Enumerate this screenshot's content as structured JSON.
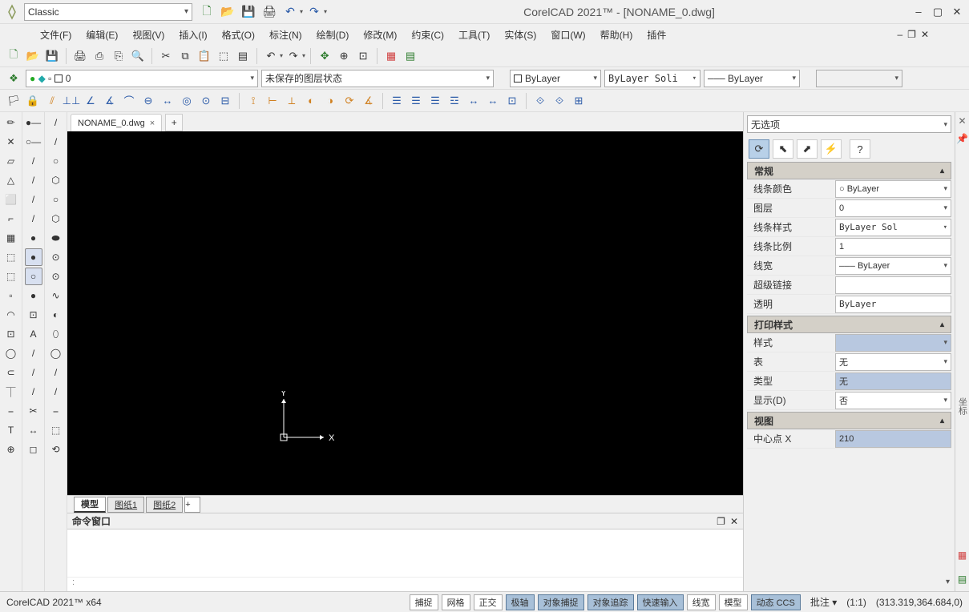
{
  "title": "CorelCAD 2021™ - [NONAME_0.dwg]",
  "workspace": "Classic",
  "menu": [
    "文件(F)",
    "编辑(E)",
    "视图(V)",
    "插入(I)",
    "格式(O)",
    "标注(N)",
    "绘制(D)",
    "修改(M)",
    "约束(C)",
    "工具(T)",
    "实体(S)",
    "窗口(W)",
    "帮助(H)",
    "插件"
  ],
  "layer_row": {
    "layer_combo": "0",
    "layer_state": "未保存的图层状态",
    "color": "ByLayer",
    "linestyle": "ByLayer   Soli",
    "lineweight": "ByLayer"
  },
  "doc_tab": "NONAME_0.dwg",
  "model_tabs": {
    "active": "模型",
    "sheets": [
      "图纸1",
      "图纸2"
    ]
  },
  "right_panel": {
    "selector": "无选项",
    "sections": {
      "general": {
        "title": "常规",
        "rows": {
          "line_color_label": "线条颜色",
          "line_color_value": "○ ByLayer",
          "layer_label": "图层",
          "layer_value": "0",
          "linestyle_label": "线条样式",
          "linestyle_value": "ByLayer   Sol",
          "linescale_label": "线条比例",
          "linescale_value": "1",
          "lineweight_label": "线宽",
          "lineweight_value": "ByLayer",
          "hyperlink_label": "超级链接",
          "hyperlink_value": "",
          "transparent_label": "透明",
          "transparent_value": "ByLayer"
        }
      },
      "printstyle": {
        "title": "打印样式",
        "rows": {
          "style_label": "样式",
          "style_value": "",
          "table_label": "表",
          "table_value": "无",
          "type_label": "类型",
          "type_value": "无",
          "show_label": "显示(D)",
          "show_value": "否"
        }
      },
      "view": {
        "title": "视图",
        "rows": {
          "center_x_label": "中心点 X",
          "center_x_value": "210"
        }
      }
    }
  },
  "cmd_title": "命令窗口",
  "cmd_prompt": ":",
  "status": {
    "app": "CorelCAD 2021™ x64",
    "buttons": [
      {
        "label": "捕捉",
        "active": false
      },
      {
        "label": "网格",
        "active": false
      },
      {
        "label": "正交",
        "active": false
      },
      {
        "label": "极轴",
        "active": true
      },
      {
        "label": "对象捕捉",
        "active": true
      },
      {
        "label": "对象追踪",
        "active": true
      },
      {
        "label": "快速输入",
        "active": true
      },
      {
        "label": "线宽",
        "active": false
      },
      {
        "label": "模型",
        "active": false
      },
      {
        "label": "动态 CCS",
        "active": true
      }
    ],
    "annot": "批注",
    "scale": "(1:1)",
    "coords": "(313.319,364.684,0)"
  },
  "ucs": {
    "x": "X",
    "y": "Y"
  },
  "vert_toolbar_1": [
    "✏",
    "✕",
    "▱",
    "△",
    "⬜",
    "⌐",
    "▦",
    "⬚",
    "⬚",
    "▫",
    "◠",
    "⊡",
    "◯",
    "⊂",
    "⏉",
    "⎯",
    "T",
    "⊕"
  ],
  "vert_toolbar_2": [
    "●—",
    "○—",
    "/",
    "/",
    "/",
    "/",
    "●",
    "●",
    "○",
    "●",
    "⊡",
    "A",
    "/",
    "/",
    "/",
    "✂",
    "↔",
    "◻"
  ],
  "vert_toolbar_3": [
    "/",
    "/",
    "○",
    "⬡",
    "○",
    "⬡",
    "⬬",
    "⊙",
    "⊙",
    "∿",
    "◐",
    "⬯",
    "◯",
    "/",
    "/",
    "⎯",
    "⬚",
    "⟲"
  ]
}
